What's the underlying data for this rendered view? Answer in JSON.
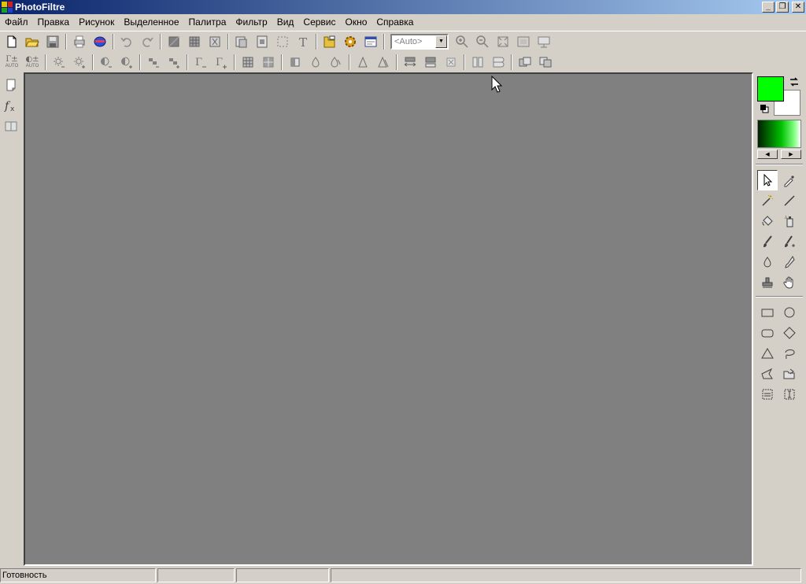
{
  "window": {
    "title": "PhotoFiltre"
  },
  "menu": [
    "Файл",
    "Правка",
    "Рисунок",
    "Выделенное",
    "Палитра",
    "Фильтр",
    "Вид",
    "Сервис",
    "Окно",
    "Справка"
  ],
  "toolbar": {
    "zoom_value": "<Auto>"
  },
  "auto_buttons": {
    "top1": "Γ±",
    "top2": "◐±",
    "bottom": "AUTO"
  },
  "colors": {
    "foreground": "#00ff00",
    "background": "#ffffff",
    "workspace": "#808080"
  },
  "statusbar": {
    "status": "Готовность",
    "panel2": "",
    "panel3": "",
    "panel4": ""
  }
}
